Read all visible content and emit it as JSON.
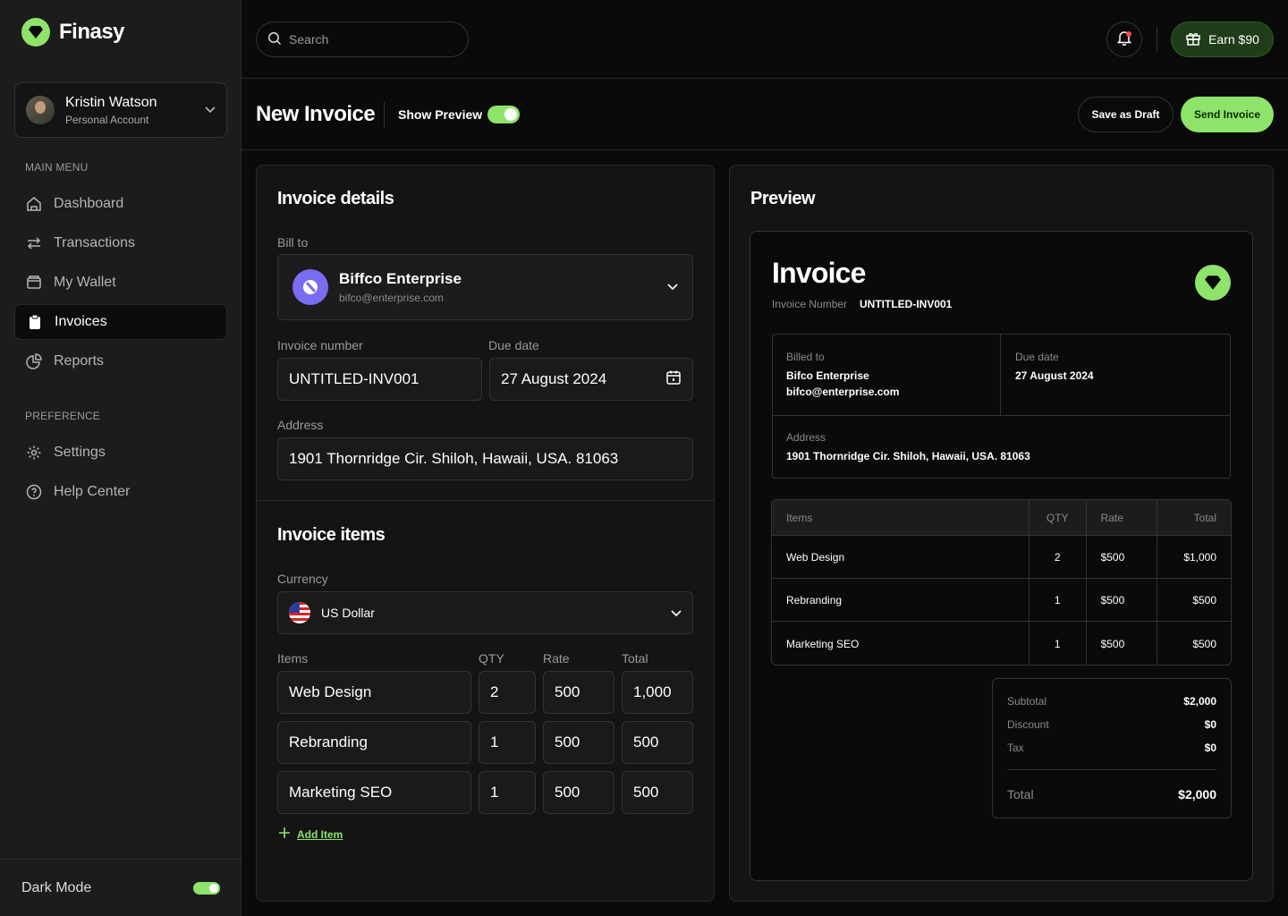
{
  "brand": {
    "name": "Finasy",
    "accent": "#8ee36a"
  },
  "account": {
    "name": "Kristin Watson",
    "type": "Personal Account"
  },
  "sidebar": {
    "main_menu_label": "MAIN MENU",
    "items": [
      {
        "label": "Dashboard",
        "icon": "home-icon"
      },
      {
        "label": "Transactions",
        "icon": "arrows-icon"
      },
      {
        "label": "My Wallet",
        "icon": "wallet-icon"
      },
      {
        "label": "Invoices",
        "icon": "clipboard-icon",
        "active": true
      },
      {
        "label": "Reports",
        "icon": "pie-chart-icon"
      }
    ],
    "preference_label": "PREFERENCE",
    "pref_items": [
      {
        "label": "Settings",
        "icon": "gear-icon"
      },
      {
        "label": "Help Center",
        "icon": "help-icon"
      }
    ],
    "dark_mode_label": "Dark Mode"
  },
  "topbar": {
    "search_placeholder": "Search",
    "earn_label": "Earn $90"
  },
  "header": {
    "title": "New Invoice",
    "show_preview_label": "Show Preview",
    "draft_label": "Save as Draft",
    "send_label": "Send Invoice"
  },
  "details": {
    "title": "Invoice details",
    "bill_to_label": "Bill to",
    "bill_to_name": "Biffco Enterprise",
    "bill_to_email": "bifco@enterprise.com",
    "invoice_number_label": "Invoice number",
    "invoice_number": "UNTITLED-INV001",
    "due_date_label": "Due date",
    "due_date": "27 August 2024",
    "address_label": "Address",
    "address": "1901 Thornridge Cir. Shiloh, Hawaii, USA. 81063"
  },
  "items_section": {
    "title": "Invoice items",
    "currency_label": "Currency",
    "currency": "US Dollar",
    "col_items": "Items",
    "col_qty": "QTY",
    "col_rate": "Rate",
    "col_total": "Total",
    "rows": [
      {
        "name": "Web Design",
        "qty": "2",
        "rate": "500",
        "total": "1,000"
      },
      {
        "name": "Rebranding",
        "qty": "1",
        "rate": "500",
        "total": "500"
      },
      {
        "name": "Marketing SEO",
        "qty": "1",
        "rate": "500",
        "total": "500"
      }
    ],
    "add_item_label": "Add Item"
  },
  "preview": {
    "title": "Preview",
    "invoice_title": "Invoice",
    "invoice_number_label": "Invoice Number",
    "invoice_number": "UNTITLED-INV001",
    "billed_to_label": "Billed to",
    "billed_to_name": "Bifco Enterprise",
    "billed_to_email": "bifco@enterprise.com",
    "due_date_label": "Due date",
    "due_date": "27 August 2024",
    "address_label": "Address",
    "address": "1901 Thornridge Cir. Shiloh, Hawaii, USA. 81063",
    "col_items": "Items",
    "col_qty": "QTY",
    "col_rate": "Rate",
    "col_total": "Total",
    "rows": [
      {
        "name": "Web Design",
        "qty": "2",
        "rate": "$500",
        "total": "$1,000"
      },
      {
        "name": "Rebranding",
        "qty": "1",
        "rate": "$500",
        "total": "$500"
      },
      {
        "name": "Marketing SEO",
        "qty": "1",
        "rate": "$500",
        "total": "$500"
      }
    ],
    "subtotal_label": "Subtotal",
    "subtotal": "$2,000",
    "discount_label": "Discount",
    "discount": "$0",
    "tax_label": "Tax",
    "tax": "$0",
    "total_label": "Total",
    "total": "$2,000"
  }
}
